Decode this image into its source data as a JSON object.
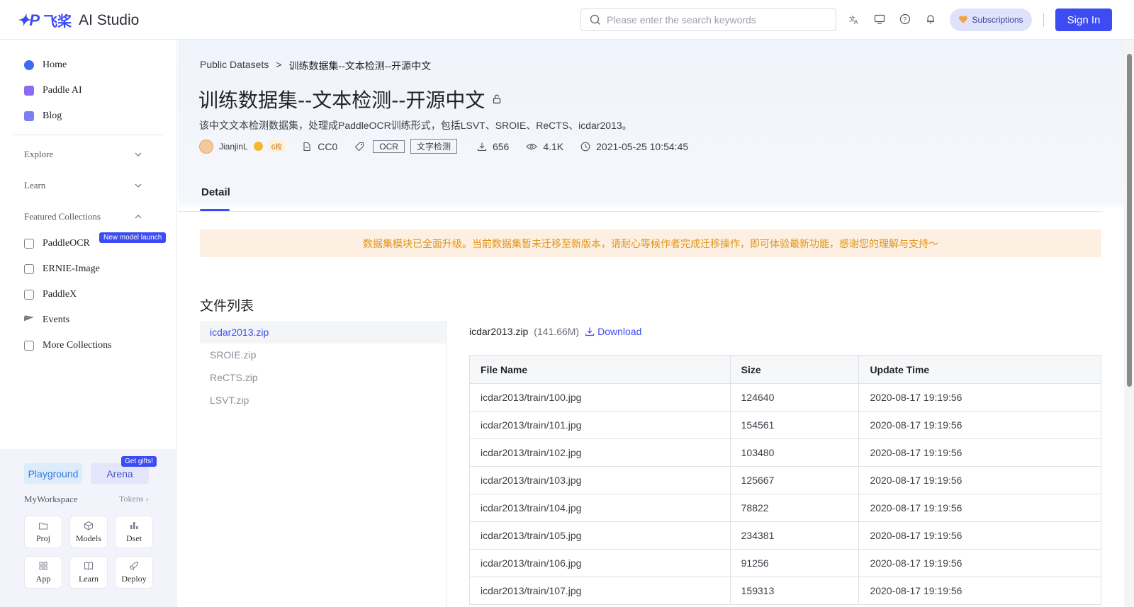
{
  "header": {
    "logo_mark": "✦P",
    "logo_cn": "飞桨",
    "logo_name": "AI Studio",
    "search_placeholder": "Please enter the search keywords",
    "subscriptions": "Subscriptions",
    "sign_in": "Sign In"
  },
  "sidebar": {
    "items": [
      {
        "label": "Home",
        "icon": "home-icon"
      },
      {
        "label": "Paddle AI",
        "icon": "robot-icon"
      },
      {
        "label": "Blog",
        "icon": "blog-icon"
      }
    ],
    "sections": {
      "explore": "Explore",
      "learn": "Learn",
      "featured": "Featured Collections"
    },
    "collections": [
      {
        "label": "PaddleOCR",
        "icon": "ocr-icon"
      },
      {
        "label": "ERNIE-Image",
        "icon": "image-icon"
      },
      {
        "label": "PaddleX",
        "icon": "paddlex-icon"
      },
      {
        "label": "Events",
        "icon": "flag-icon"
      },
      {
        "label": "More Collections",
        "icon": "collection-icon"
      }
    ],
    "new_badge": "New model launch",
    "workspace": {
      "playground": "Playground",
      "arena": "Arena",
      "gift": "Get gifts!",
      "label": "MyWorkspace",
      "tokens": "Tokens",
      "tiles": [
        "Proj",
        "Models",
        "Dset",
        "App",
        "Learn",
        "Deploy"
      ]
    }
  },
  "breadcrumb": {
    "root": "Public Datasets",
    "sep": ">",
    "current": "训练数据集--文本检测--开源中文"
  },
  "dataset": {
    "title": "训练数据集--文本检测--开源中文",
    "description": "该中文文本检测数据集，处理成PaddleOCR训练形式，包括LSVT、SROIE、ReCTS、icdar2013。",
    "author": "JianjinL",
    "coin": "6枚",
    "license": "CC0",
    "tags": [
      "OCR",
      "文字检测"
    ],
    "downloads": "656",
    "views": "4.1K",
    "date": "2021-05-25 10:54:45"
  },
  "tab": "Detail",
  "notice": "数据集模块已全面升级。当前数据集暂未迁移至新版本，请耐心等候作者完成迁移操作，即可体验最新功能，感谢您的理解与支持～",
  "files_heading": "文件列表",
  "files": [
    "icdar2013.zip",
    "SROIE.zip",
    "ReCTS.zip",
    "LSVT.zip"
  ],
  "selected_file": {
    "name": "icdar2013.zip",
    "size": "(141.66M)",
    "download": "Download"
  },
  "table": {
    "headers": [
      "File Name",
      "Size",
      "Update Time"
    ],
    "rows": [
      [
        "icdar2013/train/100.jpg",
        "124640",
        "2020-08-17 19:19:56"
      ],
      [
        "icdar2013/train/101.jpg",
        "154561",
        "2020-08-17 19:19:56"
      ],
      [
        "icdar2013/train/102.jpg",
        "103480",
        "2020-08-17 19:19:56"
      ],
      [
        "icdar2013/train/103.jpg",
        "125667",
        "2020-08-17 19:19:56"
      ],
      [
        "icdar2013/train/104.jpg",
        "78822",
        "2020-08-17 19:19:56"
      ],
      [
        "icdar2013/train/105.jpg",
        "234381",
        "2020-08-17 19:19:56"
      ],
      [
        "icdar2013/train/106.jpg",
        "91256",
        "2020-08-17 19:19:56"
      ],
      [
        "icdar2013/train/107.jpg",
        "159313",
        "2020-08-17 19:19:56"
      ]
    ]
  }
}
